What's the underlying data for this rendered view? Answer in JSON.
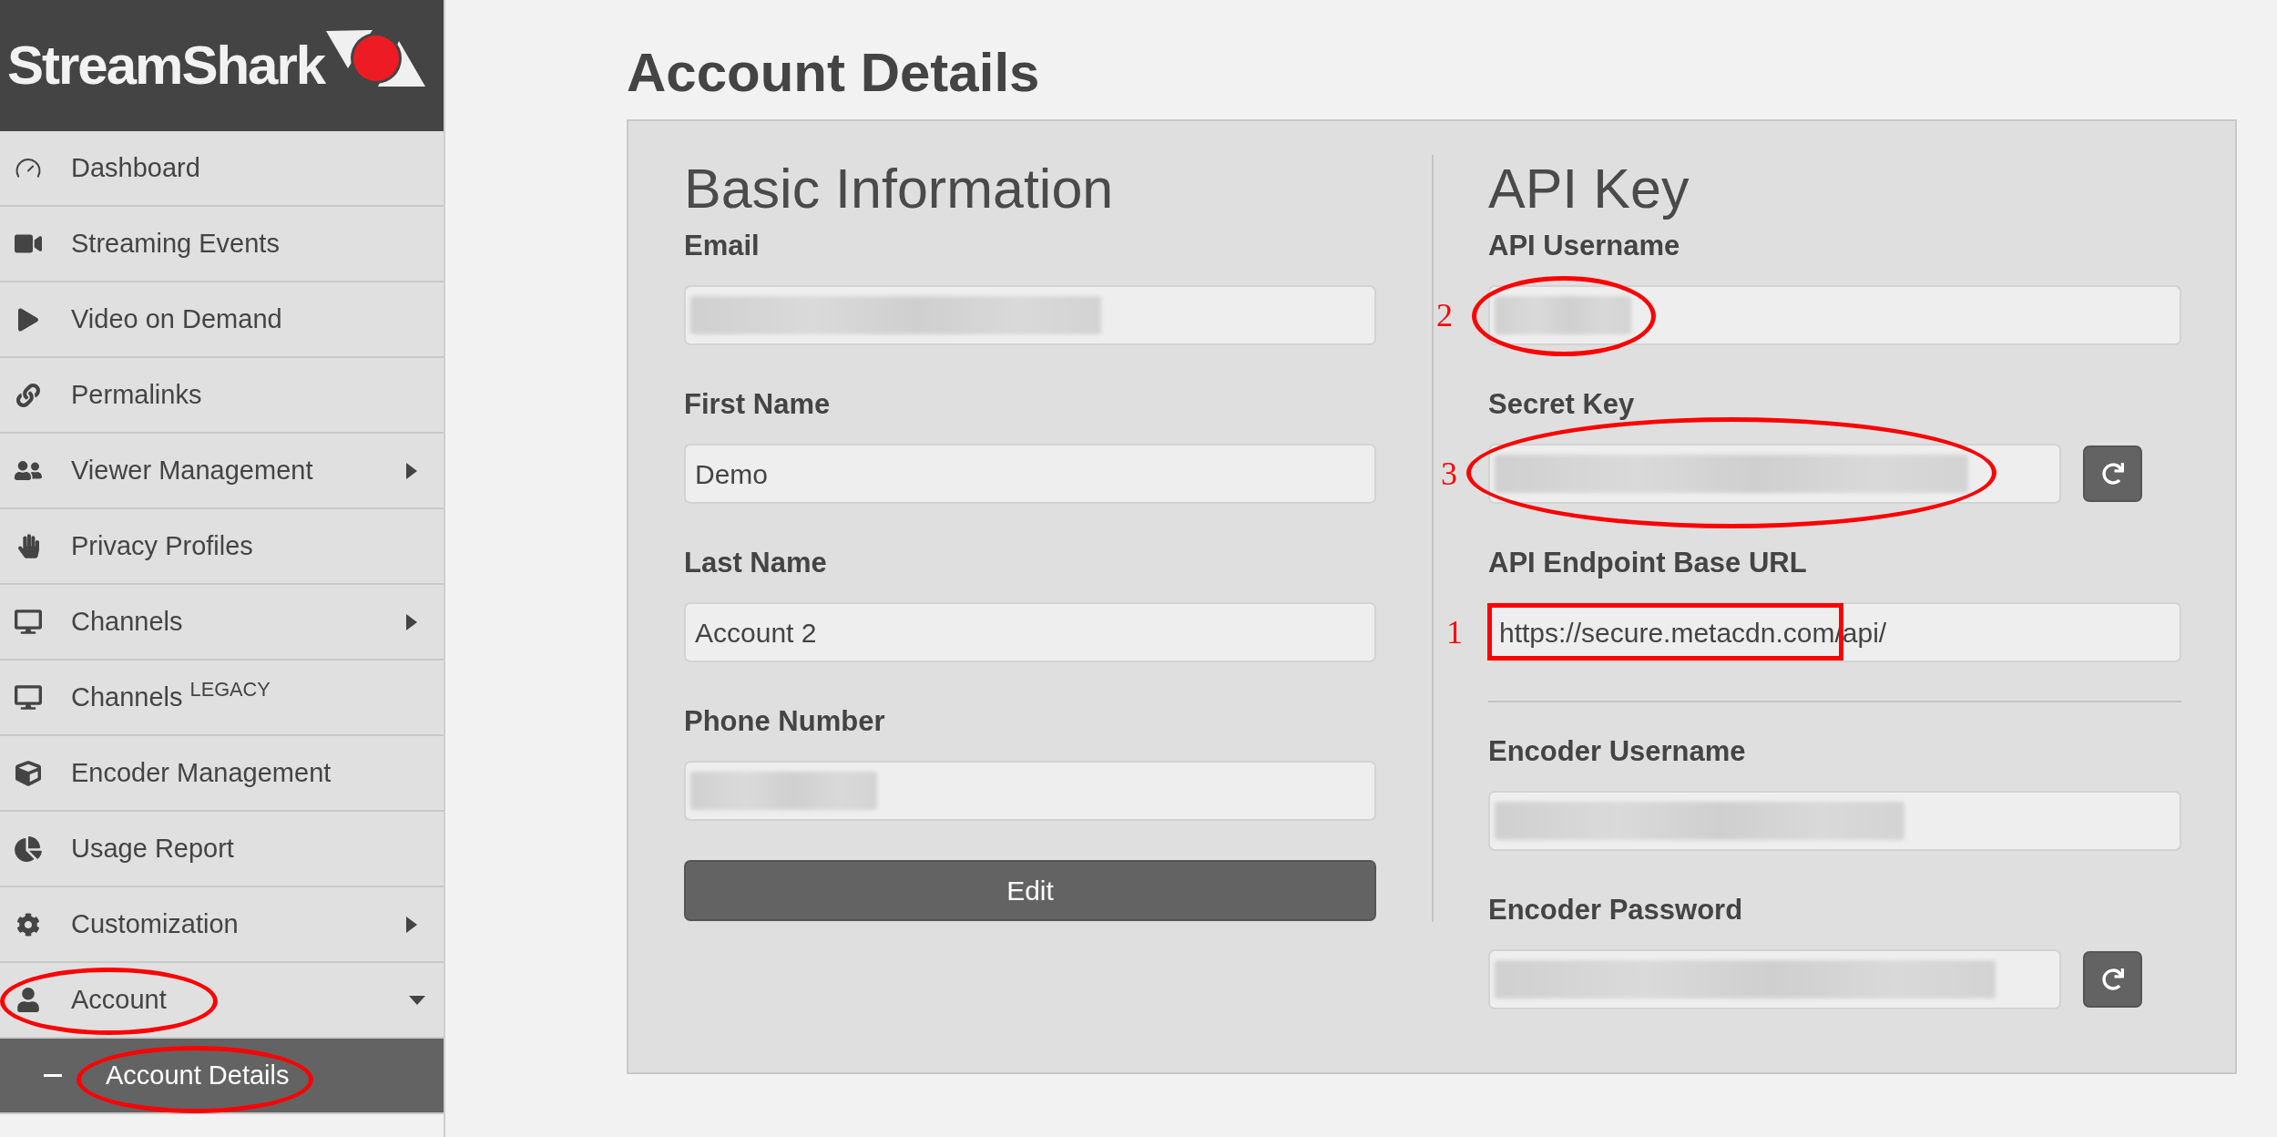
{
  "sidebar": {
    "logo": "StreamShark",
    "items": [
      {
        "label": "Dashboard",
        "selected": false
      },
      {
        "label": "Streaming Events",
        "selected": false
      },
      {
        "label": "Video on Demand",
        "selected": false
      },
      {
        "label": "Permalinks",
        "selected": false
      },
      {
        "label": "Viewer Management",
        "selected": false,
        "expanded": false
      },
      {
        "label": "Privacy Profiles",
        "selected": false
      },
      {
        "label": "Channels",
        "selected": false,
        "expanded": false
      },
      {
        "label": "Channels $^{LEGACY}$",
        "selected": false
      },
      {
        "label": "Encoder Management",
        "selected": false
      },
      {
        "label": "Usage Report",
        "selected": false
      },
      {
        "label": "Customization",
        "selected": false,
        "expanded": false
      },
      {
        "label": "Account",
        "selected": false,
        "expanded": true,
        "annotation": {
          "kind": "ellipse"
        },
        "children": [
          {
            "label": "Account Details",
            "selected": true,
            "annotation": {
              "kind": "ellipse"
            }
          }
        ]
      }
    ]
  },
  "page_title": "Account Details",
  "basic_information": {
    "heading": "Basic Information",
    "fields": [
      {
        "label": "Email",
        "kind": "text",
        "redacted": true
      },
      {
        "label": "First Name",
        "kind": "text",
        "redacted": false,
        "value": "Demo"
      },
      {
        "label": "Last Name",
        "kind": "text",
        "redacted": false,
        "value": "Account 2"
      },
      {
        "label": "Phone Number",
        "kind": "text",
        "redacted": true
      }
    ],
    "button": "Edit"
  },
  "api_key": {
    "heading": "API Key",
    "fields": [
      {
        "label": "API Username",
        "kind": "text",
        "redacted": true,
        "annotation": {
          "kind": "ellipse",
          "label": "2"
        }
      },
      {
        "label": "Secret Key",
        "kind": "regenerate",
        "redacted": true,
        "annotation": {
          "kind": "ellipse",
          "label": "3"
        }
      },
      {
        "label": "API Endpoint Base URL",
        "kind": "text",
        "redacted": false,
        "value": "https://secure.metacdn.com/api/",
        "annotation": {
          "kind": "rectangle",
          "label": "1"
        }
      }
    ]
  },
  "encoder": {
    "fields": [
      {
        "label": "Encoder Username",
        "kind": "text",
        "redacted": true
      },
      {
        "label": "Encoder Password",
        "kind": "regenerate",
        "redacted": true
      }
    ]
  }
}
